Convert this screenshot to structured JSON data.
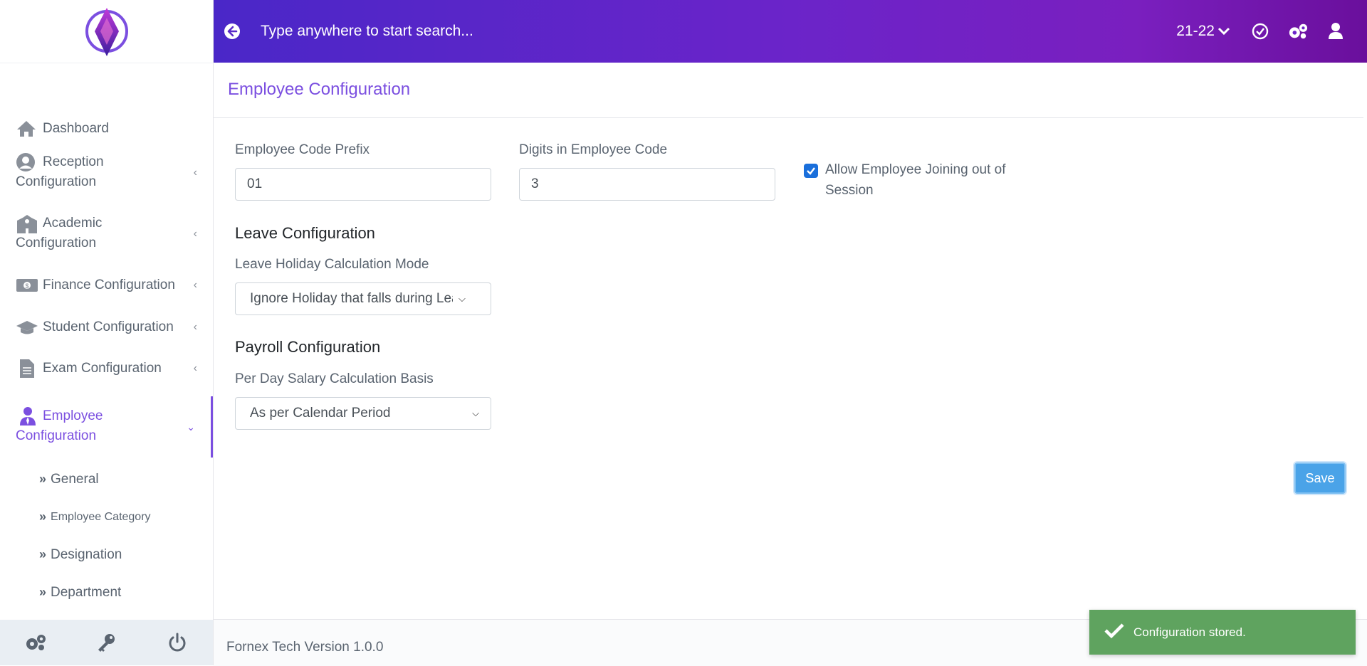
{
  "app": {
    "title": "Employee Configuration"
  },
  "colors": {
    "accent": "#7b4fe0",
    "header_gradient_start": "#4a27c8",
    "header_gradient_end": "#6a0f9c",
    "success": "#5fa35f",
    "save": "#4aa3e8"
  },
  "header": {
    "search_placeholder": "Type anywhere to start search...",
    "session": "21-22",
    "icons": [
      "back-icon",
      "check-circle-icon",
      "gears-icon",
      "user-icon"
    ]
  },
  "sidebar": {
    "items": [
      {
        "label": "Dashboard",
        "icon": "home-icon"
      },
      {
        "label": "Reception Configuration",
        "icon": "user-circle-icon"
      },
      {
        "label": "Academic Configuration",
        "icon": "school-icon"
      },
      {
        "label": "Finance Configuration",
        "icon": "money-icon"
      },
      {
        "label": "Student Configuration",
        "icon": "graduation-cap-icon"
      },
      {
        "label": "Exam Configuration",
        "icon": "document-icon"
      },
      {
        "label": "Employee Configuration",
        "icon": "employee-icon"
      }
    ],
    "subitems": [
      "General",
      "Employee Category",
      "Designation",
      "Department"
    ],
    "footer_icons": [
      "gears-icon",
      "key-icon",
      "power-icon"
    ]
  },
  "main": {
    "title": "Employee Configuration",
    "employee_code_prefix": {
      "label": "Employee Code Prefix",
      "value": "01"
    },
    "digits_in_code": {
      "label": "Digits in Employee Code",
      "value": "3"
    },
    "allow_joining": {
      "label": "Allow Employee Joining out of Session",
      "checked": true
    },
    "leave": {
      "heading": "Leave Configuration",
      "label": "Leave Holiday Calculation Mode",
      "selected": "Ignore Holiday that falls during Leave"
    },
    "payroll": {
      "heading": "Payroll Configuration",
      "label": "Per Day Salary Calculation Basis",
      "selected": "As per Calendar Period"
    },
    "save_label": "Save"
  },
  "footer": {
    "text": "Fornex Tech Version 1.0.0"
  },
  "toast": {
    "message": "Configuration stored."
  }
}
